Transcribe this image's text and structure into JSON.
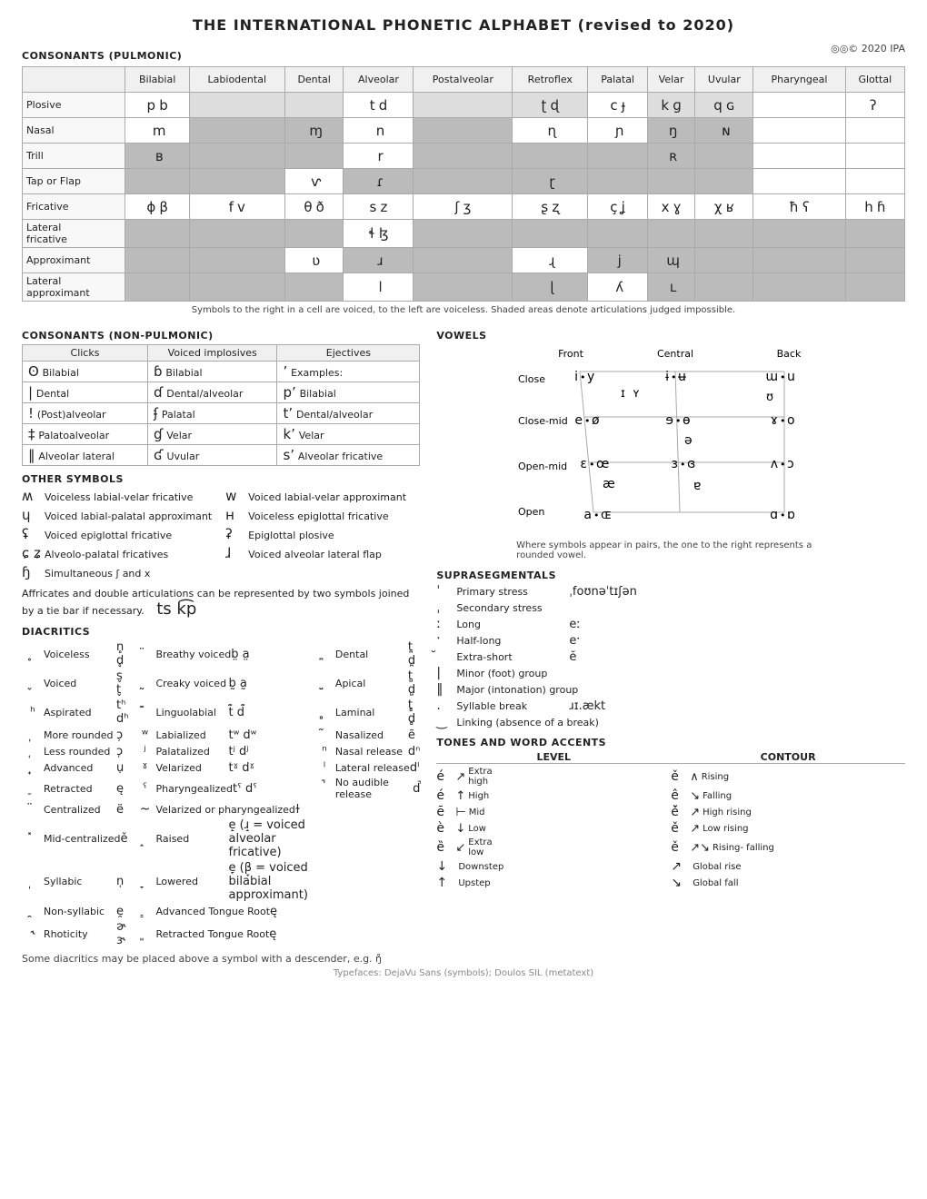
{
  "title": "THE INTERNATIONAL PHONETIC ALPHABET (revised to 2020)",
  "copyright": "◎◎© 2020 IPA",
  "pulmonic_label": "CONSONANTS (PULMONIC)",
  "pulmonic_columns": [
    "",
    "Bilabial",
    "Labiodental",
    "Dental",
    "Alveolar",
    "Postalveolar",
    "Retroflex",
    "Palatal",
    "Velar",
    "Uvular",
    "Pharyngeal",
    "Glottal"
  ],
  "pulmonic_rows": [
    {
      "label": "Plosive",
      "cells": [
        [
          "p",
          "b"
        ],
        [
          "",
          ""
        ],
        [
          "",
          ""
        ],
        [
          "t",
          "d"
        ],
        [
          "",
          ""
        ],
        [
          "ʈ",
          "ɖ"
        ],
        [
          "c",
          "ɟ"
        ],
        [
          "k",
          "ɡ"
        ],
        [
          "q",
          "ɢ"
        ],
        [
          "",
          ""
        ],
        [
          "ʔ",
          ""
        ]
      ]
    },
    {
      "label": "Nasal",
      "cells": [
        [
          "",
          "m"
        ],
        [
          "",
          ""
        ],
        [
          "",
          "ɱ"
        ],
        [
          "",
          "n"
        ],
        [
          "",
          ""
        ],
        [
          "",
          "ɳ"
        ],
        [
          "",
          "ɲ"
        ],
        [
          "",
          "ŋ"
        ],
        [
          "",
          "ɴ"
        ],
        [
          "",
          ""
        ],
        [
          "",
          ""
        ]
      ]
    },
    {
      "label": "Trill",
      "cells": [
        [
          "",
          "ʙ"
        ],
        [
          "",
          ""
        ],
        [
          "",
          ""
        ],
        [
          "",
          "r"
        ],
        [
          "",
          ""
        ],
        [
          "",
          ""
        ],
        [
          "",
          ""
        ],
        [
          "",
          "ʀ"
        ],
        [
          "",
          ""
        ],
        [
          "",
          ""
        ],
        [
          "",
          ""
        ]
      ]
    },
    {
      "label": "Tap or Flap",
      "cells": [
        [
          "",
          ""
        ],
        [
          "",
          ""
        ],
        [
          "",
          "ⱱ"
        ],
        [
          "",
          "ɾ"
        ],
        [
          "",
          ""
        ],
        [
          "",
          "ɽ"
        ],
        [
          "",
          ""
        ],
        [
          "",
          ""
        ],
        [
          "",
          ""
        ],
        [
          "",
          ""
        ],
        [
          "",
          ""
        ]
      ]
    },
    {
      "label": "Fricative",
      "cells": [
        [
          "ɸ",
          "β"
        ],
        [
          "f",
          "v"
        ],
        [
          "θ",
          "ð"
        ],
        [
          "s",
          "z"
        ],
        [
          "ʃ",
          "ʒ"
        ],
        [
          "ʂ",
          "ʐ"
        ],
        [
          "ç",
          "ʝ"
        ],
        [
          "x",
          "ɣ"
        ],
        [
          "χ",
          "ʁ"
        ],
        [
          "ħ",
          "ʕ"
        ],
        [
          "h",
          "ɦ"
        ]
      ]
    },
    {
      "label": "Lateral\nfricative",
      "cells": [
        [
          "",
          ""
        ],
        [
          "",
          ""
        ],
        [
          "",
          ""
        ],
        [
          "ɬ",
          "ɮ"
        ],
        [
          "",
          ""
        ],
        [
          "",
          ""
        ],
        [
          "",
          ""
        ],
        [
          "",
          ""
        ],
        [
          "",
          ""
        ],
        [
          "",
          ""
        ],
        [
          "",
          ""
        ]
      ]
    },
    {
      "label": "Approximant",
      "cells": [
        [
          "",
          ""
        ],
        [
          "",
          ""
        ],
        [
          "",
          "ʋ"
        ],
        [
          "",
          "ɹ"
        ],
        [
          "",
          ""
        ],
        [
          "",
          "ɻ"
        ],
        [
          "",
          "j"
        ],
        [
          "",
          "ɰ"
        ],
        [
          "",
          ""
        ],
        [
          "",
          ""
        ],
        [
          "",
          ""
        ]
      ]
    },
    {
      "label": "Lateral\napproximant",
      "cells": [
        [
          "",
          ""
        ],
        [
          "",
          ""
        ],
        [
          "",
          ""
        ],
        [
          "",
          "l"
        ],
        [
          "",
          ""
        ],
        [
          "",
          "ɭ"
        ],
        [
          "",
          "ʎ"
        ],
        [
          "",
          "ʟ"
        ],
        [
          "",
          ""
        ],
        [
          "",
          ""
        ],
        [
          "",
          ""
        ]
      ]
    }
  ],
  "pulmonic_note": "Symbols to the right in a cell are voiced, to the left are voiceless. Shaded areas denote articulations judged impossible.",
  "nonpulmonic_label": "CONSONANTS (NON-PULMONIC)",
  "clicks_label": "Clicks",
  "voiced_implosives_label": "Voiced implosives",
  "ejectives_label": "Ejectives",
  "clicks": [
    {
      "sym": "ʘ",
      "desc": "Bilabial"
    },
    {
      "sym": "|",
      "desc": "Dental"
    },
    {
      "sym": "!",
      "desc": "(Post)alveolar"
    },
    {
      "sym": "‡",
      "desc": "Palatoalveolar"
    },
    {
      "sym": "‖",
      "desc": "Alveolar lateral"
    }
  ],
  "voiced_implosives": [
    {
      "sym": "ɓ",
      "desc": "Bilabial"
    },
    {
      "sym": "ɗ",
      "desc": "Dental/alveolar"
    },
    {
      "sym": "ʄ",
      "desc": "Palatal"
    },
    {
      "sym": "ɠ",
      "desc": "Velar"
    },
    {
      "sym": "ʛ",
      "desc": "Uvular"
    }
  ],
  "ejectives": [
    {
      "sym": "ʼ",
      "desc": "Examples:"
    },
    {
      "sym": "pʼ",
      "desc": "Bilabial"
    },
    {
      "sym": "tʼ",
      "desc": "Dental/alveolar"
    },
    {
      "sym": "kʼ",
      "desc": "Velar"
    },
    {
      "sym": "sʼ",
      "desc": "Alveolar fricative"
    }
  ],
  "vowels_label": "VOWELS",
  "vowels_row_labels": [
    "Close",
    "Close-mid",
    "Open-mid",
    "Open"
  ],
  "vowels_col_labels": [
    "Front",
    "Central",
    "Back"
  ],
  "other_symbols_label": "OTHER SYMBOLS",
  "other_symbols": [
    {
      "sym": "ʍ",
      "desc": "Voiceless labial-velar fricative"
    },
    {
      "sym": "w",
      "desc": "Voiced labial-velar approximant"
    },
    {
      "sym": "ɥ",
      "desc": "Voiced labial-palatal approximant"
    },
    {
      "sym": "ʜ",
      "desc": "Voiceless epiglottal fricative"
    },
    {
      "sym": "ʢ",
      "desc": "Voiced epiglottal fricative"
    },
    {
      "sym": "ʡ",
      "desc": "Epiglottal plosive"
    },
    {
      "sym": "ɕ ʑ",
      "desc": "Alveolo-palatal fricatives"
    },
    {
      "sym": "ɺ",
      "desc": "Voiced alveolar lateral flap"
    },
    {
      "sym": "ɧ",
      "desc": "Simultaneous ʃ and x"
    },
    {
      "sym": "ts k͡p",
      "desc": "Affricates and double articulations can be represented by two symbols joined by a tie bar if necessary."
    }
  ],
  "diacritics_label": "DIACRITICS",
  "diacritics": [
    {
      "sym": "̥",
      "desc": "Voiceless",
      "example": "n̥ d̥",
      "col": 0
    },
    {
      "sym": "̈",
      "desc": "Breathy voiced",
      "example": "b̤ a̤",
      "col": 1
    },
    {
      "sym": "̪",
      "desc": "Dental",
      "example": "t̪ d̪",
      "col": 2
    },
    {
      "sym": "̬",
      "desc": "Voiced",
      "example": "s̬ t̬",
      "col": 0
    },
    {
      "sym": "̰",
      "desc": "Creaky voiced",
      "example": "b̰ a̰",
      "col": 1
    },
    {
      "sym": "̺",
      "desc": "Apical",
      "example": "t̺ d̺",
      "col": 2
    },
    {
      "sym": "ʰ",
      "desc": "Aspirated",
      "example": "tʰ dʰ",
      "col": 0
    },
    {
      "sym": "͊",
      "desc": "Linguolabial",
      "example": "t͊ d͊",
      "col": 1
    },
    {
      "sym": "̻",
      "desc": "Laminal",
      "example": "t̻ d̻",
      "col": 2
    },
    {
      "sym": "̹",
      "desc": "More rounded",
      "example": "ɔ̹",
      "col": 0
    },
    {
      "sym": "ʷ",
      "desc": "Labialized",
      "example": "tʷ dʷ",
      "col": 1
    },
    {
      "sym": "̃",
      "desc": "Nasalized",
      "example": "ẽ",
      "col": 2
    },
    {
      "sym": "̜",
      "desc": "Less rounded",
      "example": "ɔ̜",
      "col": 0
    },
    {
      "sym": "ʲ",
      "desc": "Palatalized",
      "example": "tʲ dʲ",
      "col": 1
    },
    {
      "sym": "ⁿ",
      "desc": "Nasal release",
      "example": "dⁿ",
      "col": 2
    },
    {
      "sym": "̟",
      "desc": "Advanced",
      "example": "ụ",
      "col": 0
    },
    {
      "sym": "ˠ",
      "desc": "Velarized",
      "example": "tˠ dˠ",
      "col": 1
    },
    {
      "sym": "ˡ",
      "desc": "Lateral release",
      "example": "dˡ",
      "col": 2
    },
    {
      "sym": "̠",
      "desc": "Retracted",
      "example": "ę",
      "col": 0
    },
    {
      "sym": "ˤ",
      "desc": "Pharyngealized",
      "example": "tˤ dˤ",
      "col": 1
    },
    {
      "sym": "̚",
      "desc": "No audible release",
      "example": "d̚",
      "col": 2
    },
    {
      "sym": "̈",
      "desc": "Centralized",
      "example": "ë",
      "col": 0
    },
    {
      "sym": "~",
      "desc": "Velarized or pharyngealized",
      "example": "ɫ",
      "col": 1
    },
    {
      "sym": "",
      "desc": "",
      "example": "",
      "col": 2
    },
    {
      "sym": "̽",
      "desc": "Mid-centralized",
      "example": "ě",
      "col": 0
    },
    {
      "sym": "̝",
      "desc": "Raised",
      "example": "e̝  (ɹ̝ = voiced alveolar fricative)",
      "col": 1
    },
    {
      "sym": "",
      "desc": "",
      "example": "",
      "col": 2
    },
    {
      "sym": "̩",
      "desc": "Syllabic",
      "example": "n̩",
      "col": 0
    },
    {
      "sym": "̞",
      "desc": "Lowered",
      "example": "e̞  (β̞ = voiced bilabial approximant)",
      "col": 1
    },
    {
      "sym": "",
      "desc": "",
      "example": "",
      "col": 2
    },
    {
      "sym": "̯",
      "desc": "Non-syllabic",
      "example": "e̯",
      "col": 0
    },
    {
      "sym": "͇",
      "desc": "Advanced Tongue Root",
      "example": "ę",
      "col": 1
    },
    {
      "sym": "",
      "desc": "",
      "example": "",
      "col": 2
    },
    {
      "sym": "˞",
      "desc": "Rhoticity",
      "example": "ɚ ɝ",
      "col": 0
    },
    {
      "sym": "͈",
      "desc": "Retracted Tongue Root",
      "example": "ę",
      "col": 1
    },
    {
      "sym": "",
      "desc": "",
      "example": "",
      "col": 2
    }
  ],
  "suprasegmentals_label": "SUPRASEGMENTALS",
  "suprasegmentals": [
    {
      "sym": "ˈ",
      "desc": "Primary stress",
      "example": "ˌfoʊnəˈtɪʃən"
    },
    {
      "sym": "ˌ",
      "desc": "Secondary stress",
      "example": ""
    },
    {
      "sym": "ː",
      "desc": "Long",
      "example": "eː"
    },
    {
      "sym": "ˑ",
      "desc": "Half-long",
      "example": "eˑ"
    },
    {
      "sym": "̆",
      "desc": "Extra-short",
      "example": "ĕ"
    },
    {
      "sym": "|",
      "desc": "Minor (foot) group",
      "example": ""
    },
    {
      "sym": "‖",
      "desc": "Major (intonation) group",
      "example": ""
    },
    {
      "sym": ".",
      "desc": "Syllable break",
      "example": "ɹɪ.ækt"
    },
    {
      "sym": "‿",
      "desc": "Linking (absence of a break)",
      "example": ""
    }
  ],
  "tones_label": "TONES AND WORD ACCENTS",
  "tones_level_label": "LEVEL",
  "tones_contour_label": "CONTOUR",
  "tones": [
    {
      "left_sym": "é or ↗",
      "left_extra": "Extra\nhigh",
      "right_sym": "ě or ∧",
      "right_desc": "Rising"
    },
    {
      "left_sym": "é ↑",
      "left_extra": "High",
      "right_sym": "ê ↘",
      "right_desc": "Falling"
    },
    {
      "left_sym": "ē ⊣",
      "left_extra": "Mid",
      "right_sym": "ê̌ ↗",
      "right_desc": "High\nrising"
    },
    {
      "left_sym": "è ↓",
      "left_extra": "Low",
      "right_sym": "ě ↗",
      "right_desc": "Low\nrising"
    },
    {
      "left_sym": "ȅ ↙",
      "left_extra": "Extra\nlow",
      "right_sym": "ě̞ ↗↘",
      "right_desc": "Rising-\nfalling"
    },
    {
      "left_sym": "↓",
      "left_extra": "Downstep",
      "right_sym": "↗",
      "right_desc": "Global rise"
    },
    {
      "left_sym": "↑",
      "left_extra": "Upstep",
      "right_sym": "↘",
      "right_desc": "Global fall"
    }
  ],
  "footer_note": "Some diacritics may be placed above a symbol with a descender, e.g. ŋ̊",
  "typefaces_note": "Typefaces: DejaVu Sans (symbols); Doulos SIL (metatext)"
}
